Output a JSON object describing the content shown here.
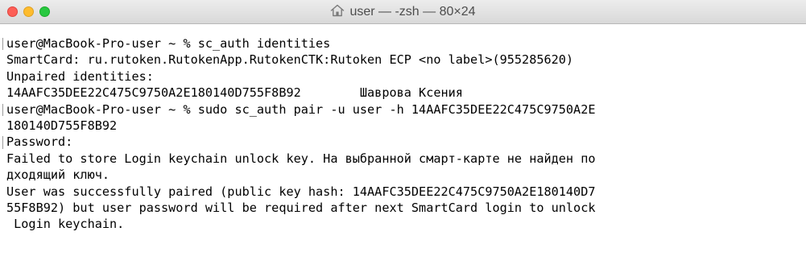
{
  "window": {
    "title": "user — -zsh — 80×24",
    "title_icon": "home-icon",
    "colors": {
      "close": "#fd5f57",
      "minimize": "#febc2e",
      "zoom": "#28c840",
      "background": "#ffffff",
      "text": "#000000"
    }
  },
  "terminal": {
    "lines": [
      "user@MacBook-Pro-user ~ % sc_auth identities",
      "SmartCard: ru.rutoken.RutokenApp.RutokenCTK:Rutoken ECP <no label>(955285620)",
      "Unpaired identities:",
      "14AAFC35DEE22C475C9750A2E180140D755F8B92        Шаврова Ксения",
      "user@MacBook-Pro-user ~ % sudo sc_auth pair -u user -h 14AAFC35DEE22C475C9750A2E",
      "180140D755F8B92",
      "Password:",
      "Failed to store Login keychain unlock key. На выбранной смарт-карте не найден по",
      "дходящий ключ.",
      "User was successfully paired (public key hash: 14AAFC35DEE22C475C9750A2E180140D7",
      "55F8B92) but user password will be required after next SmartCard login to unlock",
      " Login keychain."
    ]
  }
}
